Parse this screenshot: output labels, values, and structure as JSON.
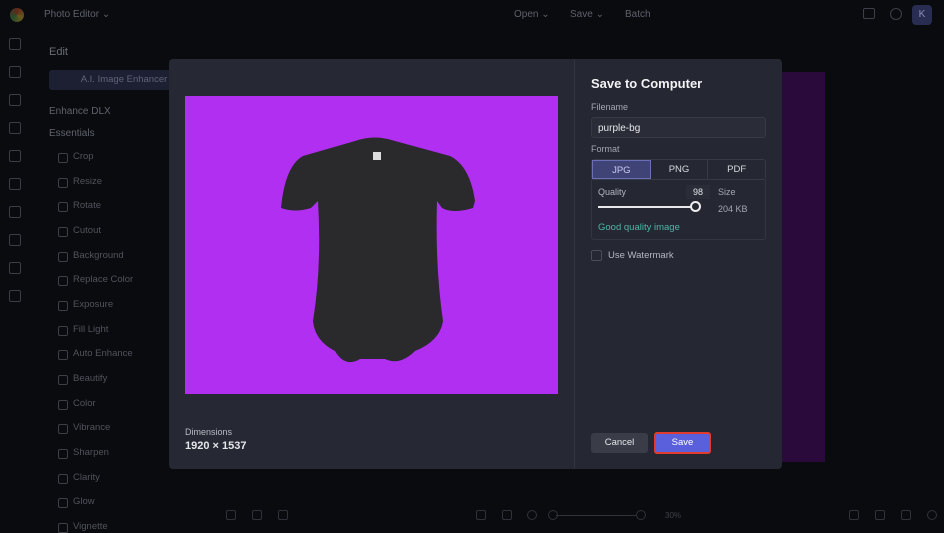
{
  "topbar": {
    "app": "Photo Editor ⌄",
    "open": "Open ⌄",
    "save": "Save ⌄",
    "batch": "Batch",
    "avatar": "K"
  },
  "sidebar": {
    "heading": "Edit",
    "ai_button": "A.I. Image Enhancer",
    "enhance": "Enhance DLX",
    "essentials": "Essentials",
    "items": [
      "Crop",
      "Resize",
      "Rotate",
      "Cutout",
      "Background",
      "Replace Color",
      "Exposure",
      "Fill Light",
      "Auto Enhance",
      "Beautify",
      "Color",
      "Vibrance",
      "Sharpen",
      "Clarity",
      "Glow",
      "Vignette"
    ]
  },
  "dialog": {
    "title": "Save to Computer",
    "filename_label": "Filename",
    "filename": "purple-bg",
    "format_label": "Format",
    "formats": [
      "JPG",
      "PNG",
      "PDF"
    ],
    "selected_format": "JPG",
    "quality_label": "Quality",
    "quality": "98",
    "size_label": "Size",
    "size": "204 KB",
    "quality_note": "Good quality image",
    "watermark_label": "Use Watermark",
    "watermark_checked": false,
    "dimensions_label": "Dimensions",
    "dimensions": "1920 × 1537",
    "cancel": "Cancel",
    "save": "Save",
    "preview_bg": "#b02ff0"
  },
  "bottombar": {
    "zoom": "30%"
  }
}
